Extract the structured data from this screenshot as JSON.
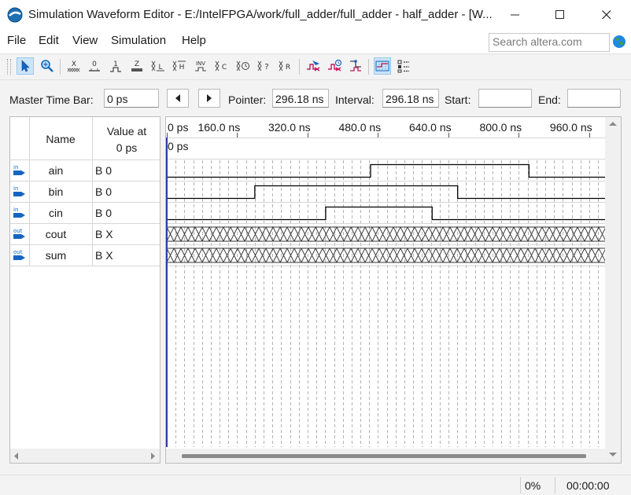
{
  "window": {
    "title": "Simulation Waveform Editor - E:/IntelFPGA/work/full_adder/full_adder - half_adder - [W..."
  },
  "menu": {
    "file": "File",
    "edit": "Edit",
    "view": "View",
    "simulation": "Simulation",
    "help": "Help"
  },
  "search": {
    "placeholder": "Search altera.com",
    "value": ""
  },
  "toolbar": {
    "icons": [
      "selection-tool",
      "zoom-tool",
      "forcing-unknown",
      "forcing-low",
      "forcing-high",
      "high-impedance",
      "weak-low",
      "weak-high",
      "invert",
      "count-value",
      "forcing-clock",
      "random-values",
      "overwrite-value",
      "run-functional-simulation",
      "run-timing-simulation",
      "generate-netlist",
      "snap-to-grid",
      "sort"
    ],
    "active": [
      "selection-tool",
      "snap-to-grid"
    ]
  },
  "timebar": {
    "master_label": "Master Time Bar:",
    "master_value": "0 ps",
    "pointer_label": "Pointer:",
    "pointer_value": "296.18 ns",
    "interval_label": "Interval:",
    "interval_value": "296.18 ns",
    "start_label": "Start:",
    "start_value": "",
    "end_label": "End:",
    "end_value": ""
  },
  "nodes": {
    "header_name": "Name",
    "header_value_line1": "Value at",
    "header_value_line2": "0 ps",
    "rows": [
      {
        "dir": "in",
        "name": "ain",
        "value": "B 0"
      },
      {
        "dir": "in",
        "name": "bin",
        "value": "B 0"
      },
      {
        "dir": "in",
        "name": "cin",
        "value": "B 0"
      },
      {
        "dir": "out",
        "name": "cout",
        "value": "B X"
      },
      {
        "dir": "out",
        "name": "sum",
        "value": "B X"
      }
    ]
  },
  "waveform": {
    "time_axis_ticks": [
      "0 ps",
      "160.0 ns",
      "320.0 ns",
      "480.0 ns",
      "640.0 ns",
      "800.0 ns",
      "960.0 ns"
    ],
    "cursor_label": "0 ps",
    "time_unit": "ns",
    "visible_range_ns": [
      0,
      1000
    ],
    "signals": [
      {
        "name": "ain",
        "type": "binary",
        "segments": [
          {
            "from": 0,
            "to": 463,
            "level": 0
          },
          {
            "from": 463,
            "to": 823,
            "level": 1
          },
          {
            "from": 823,
            "to": 1000,
            "level": 0
          }
        ]
      },
      {
        "name": "bin",
        "type": "binary",
        "segments": [
          {
            "from": 0,
            "to": 200,
            "level": 0
          },
          {
            "from": 200,
            "to": 661,
            "level": 1
          },
          {
            "from": 661,
            "to": 1000,
            "level": 0
          }
        ]
      },
      {
        "name": "cin",
        "type": "binary",
        "segments": [
          {
            "from": 0,
            "to": 361,
            "level": 0
          },
          {
            "from": 361,
            "to": 603,
            "level": 1
          },
          {
            "from": 603,
            "to": 1000,
            "level": 0
          }
        ]
      },
      {
        "name": "cout",
        "type": "unknown"
      },
      {
        "name": "sum",
        "type": "unknown"
      }
    ]
  },
  "status": {
    "progress": "0%",
    "elapsed": "00:00:00"
  },
  "colors": {
    "cursor": "#2c3fa3",
    "waveform": "#000000",
    "accent": "#0078d4"
  }
}
